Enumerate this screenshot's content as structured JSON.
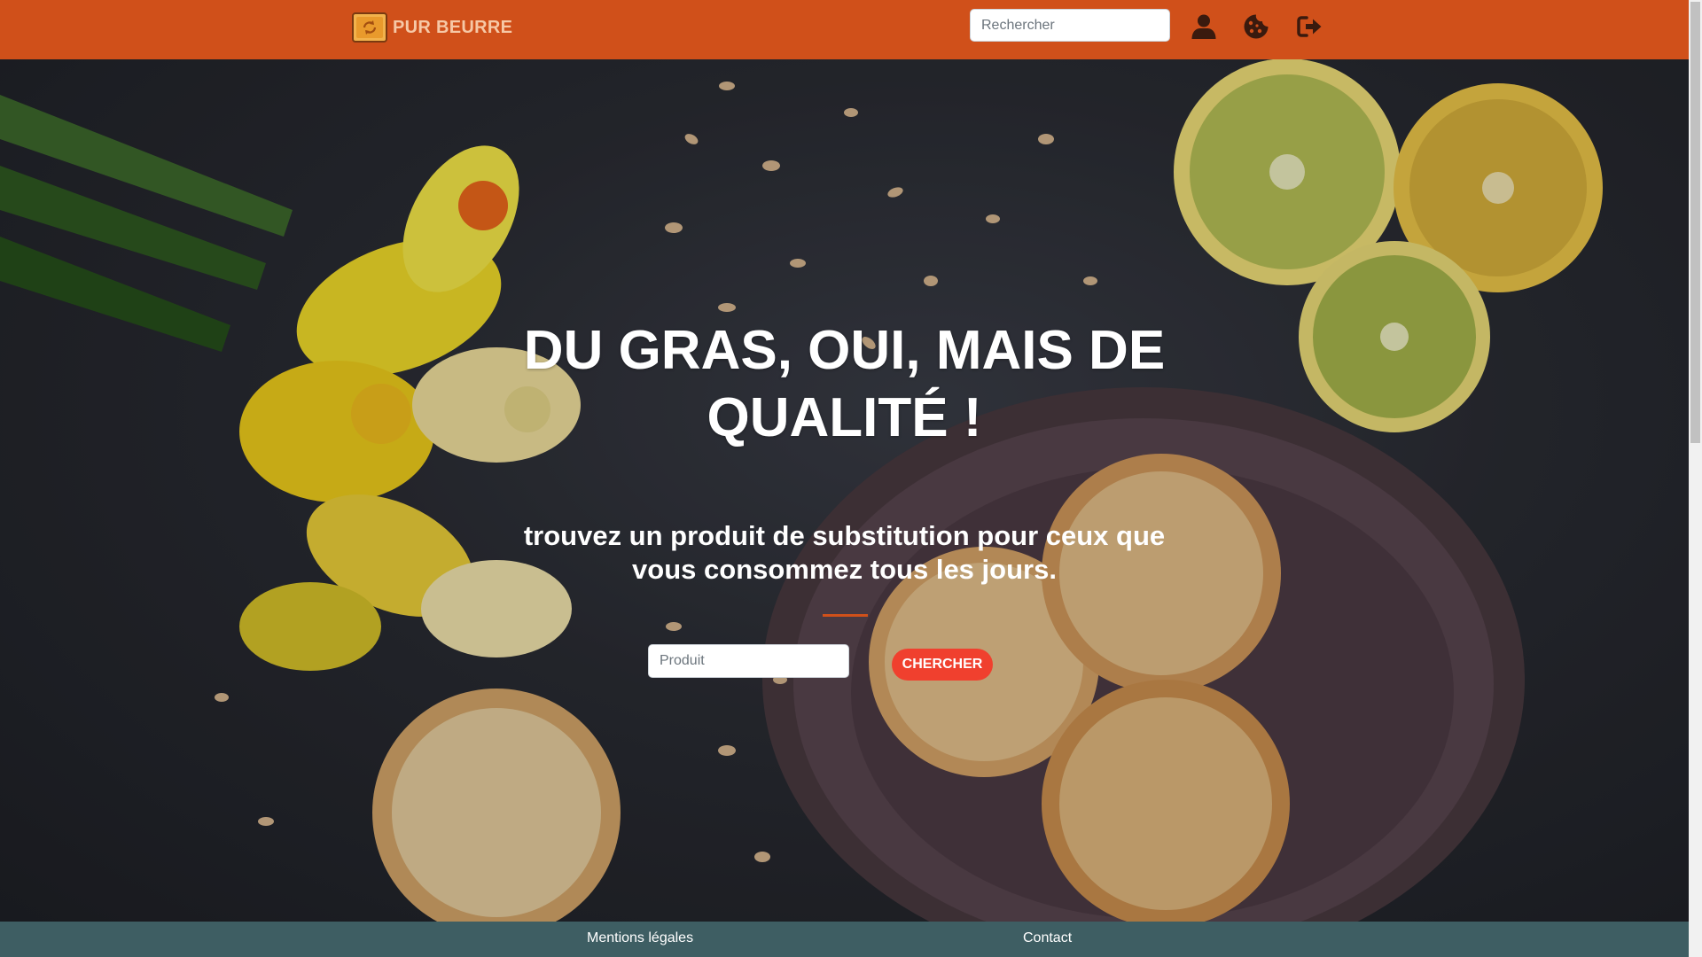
{
  "navbar": {
    "brand_text": "PUR BEURRE",
    "search_placeholder": "Rechercher",
    "icons": [
      "user-icon",
      "cookie-icon",
      "sign-out-icon"
    ]
  },
  "hero": {
    "headline": "DU GRAS, OUI, MAIS DE QUALITÉ !",
    "subline": "trouvez un produit de substitution pour ceux que vous consommez tous les jours.",
    "product_placeholder": "Produit",
    "search_button": "CHERCHER"
  },
  "footer": {
    "legal_link": "Mentions légales",
    "contact_link": "Contact"
  },
  "colors": {
    "navbar": "#d0501a",
    "brand_text": "#f6c8a6",
    "button": "#f0402e",
    "divider": "#d0501a",
    "footer": "#3e5e63"
  }
}
